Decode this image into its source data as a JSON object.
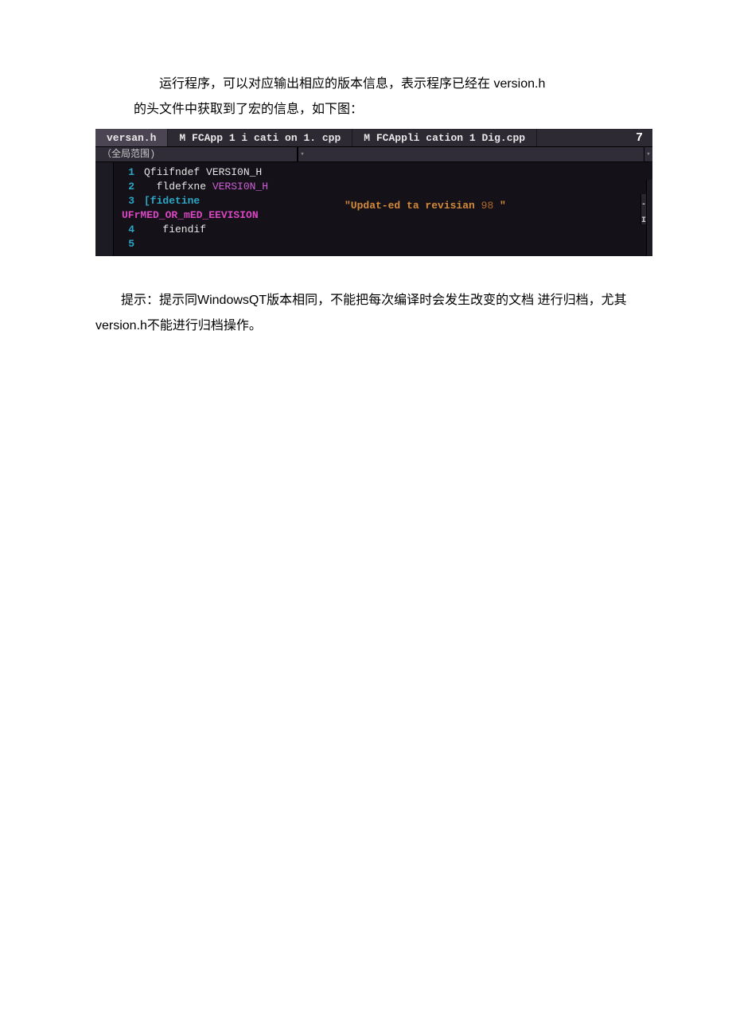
{
  "doc": {
    "para1a": "运行程序，可以对应输出相应的版本信息，表示程序已经在 version.h",
    "para1b": "的头文件中获取到了宏的信息，如下图：",
    "para2": "提示：提示同WindowsQT版本相同，不能把每次编译时会发生改变的文档 进行归档，尤其version.h不能进行归档操作。"
  },
  "ide": {
    "tabs": [
      "versan.h",
      "M FCApp 1 i cati on 1. cpp",
      "M FCAppli cation 1 Dig.cpp"
    ],
    "tab_right": "7",
    "scope_label": "（全局范围)",
    "side_badge": "-I.",
    "overlay_str_prefix": "\"Updat-ed ta revisian ",
    "overlay_str_num": "98",
    "overlay_str_suffix": " \"",
    "lines": [
      {
        "n": "1",
        "tokens": [
          {
            "t": "Qfiifndef ",
            "c": "kw-white"
          },
          {
            "t": "VERSI0N_H",
            "c": "kw-white"
          }
        ]
      },
      {
        "n": "2",
        "tokens": [
          {
            "t": "  fldefxne ",
            "c": "kw-white"
          },
          {
            "t": "VERSI0N_H",
            "c": "kw-magenta"
          }
        ]
      },
      {
        "n": "3",
        "tokens": [
          {
            "t": "[fidetine",
            "c": "kw-cyan"
          }
        ]
      }
    ],
    "macro": "UFrMED_OR_mED_EEVISION",
    "lines_after": [
      {
        "n": "4",
        "tokens": [
          {
            "t": "   fiendif",
            "c": "kw-white"
          }
        ]
      },
      {
        "n": "5",
        "tokens": [
          {
            "t": "",
            "c": "kw-white"
          }
        ]
      }
    ]
  }
}
